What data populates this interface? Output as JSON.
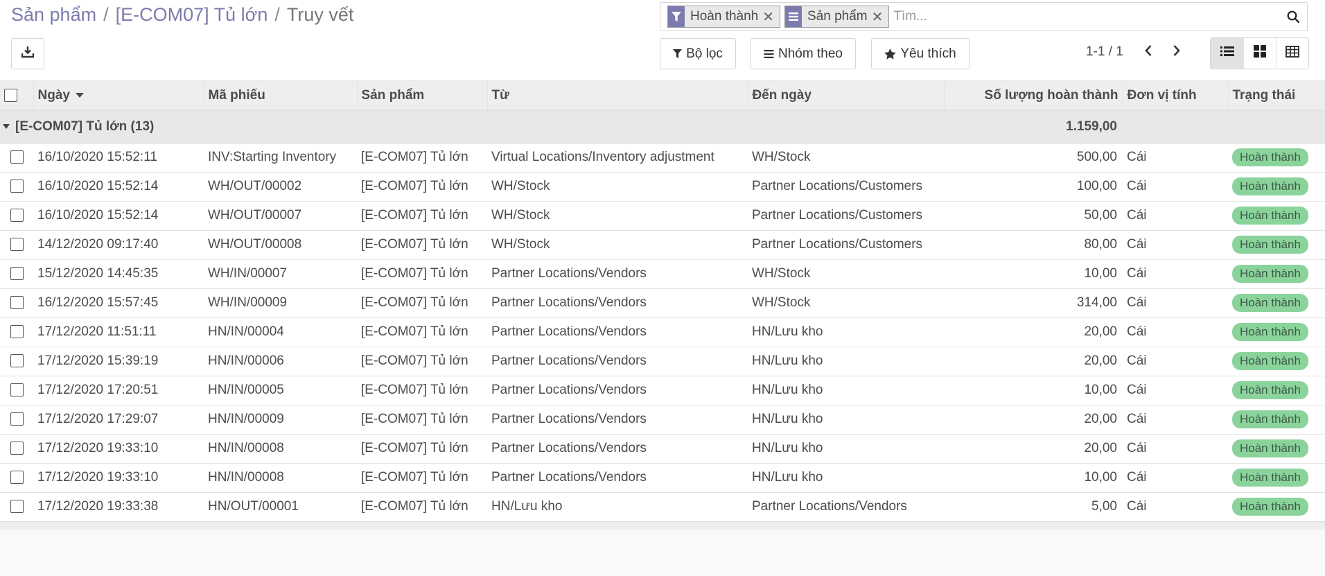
{
  "breadcrumb": {
    "items": [
      "Sản phẩm",
      "[E-COM07] Tủ lớn"
    ],
    "separator": "/",
    "current": "Truy vết"
  },
  "search": {
    "facets": [
      {
        "icon": "filter-icon",
        "value": "Hoàn thành"
      },
      {
        "icon": "group-by-icon",
        "value": "Sản phẩm"
      }
    ],
    "placeholder": "Tìm..."
  },
  "toolbar": {
    "filter_label": "Bộ lọc",
    "group_label": "Nhóm theo",
    "favorites_label": "Yêu thích"
  },
  "pager": {
    "text": "1-1 / 1"
  },
  "colors": {
    "accent": "#7c7bad",
    "badge_bg": "#8ad49c",
    "badge_text": "#3d5a46"
  },
  "table": {
    "headers": {
      "date": "Ngày",
      "reference": "Mã phiếu",
      "product": "Sản phẩm",
      "from": "Từ",
      "to": "Đến ngày",
      "qty_done": "Số lượng hoàn thành",
      "uom": "Đơn vị tính",
      "status": "Trạng thái"
    },
    "group": {
      "label": "[E-COM07] Tủ lớn (13)",
      "total": "1.159,00"
    },
    "rows": [
      {
        "date": "16/10/2020 15:52:11",
        "reference": "INV:Starting Inventory",
        "product": "[E-COM07] Tủ lớn",
        "from": "Virtual Locations/Inventory adjustment",
        "to": "WH/Stock",
        "qty": "500,00",
        "uom": "Cái",
        "status": "Hoàn thành"
      },
      {
        "date": "16/10/2020 15:52:14",
        "reference": "WH/OUT/00002",
        "product": "[E-COM07] Tủ lớn",
        "from": "WH/Stock",
        "to": "Partner Locations/Customers",
        "qty": "100,00",
        "uom": "Cái",
        "status": "Hoàn thành"
      },
      {
        "date": "16/10/2020 15:52:14",
        "reference": "WH/OUT/00007",
        "product": "[E-COM07] Tủ lớn",
        "from": "WH/Stock",
        "to": "Partner Locations/Customers",
        "qty": "50,00",
        "uom": "Cái",
        "status": "Hoàn thành"
      },
      {
        "date": "14/12/2020 09:17:40",
        "reference": "WH/OUT/00008",
        "product": "[E-COM07] Tủ lớn",
        "from": "WH/Stock",
        "to": "Partner Locations/Customers",
        "qty": "80,00",
        "uom": "Cái",
        "status": "Hoàn thành"
      },
      {
        "date": "15/12/2020 14:45:35",
        "reference": "WH/IN/00007",
        "product": "[E-COM07] Tủ lớn",
        "from": "Partner Locations/Vendors",
        "to": "WH/Stock",
        "qty": "10,00",
        "uom": "Cái",
        "status": "Hoàn thành"
      },
      {
        "date": "16/12/2020 15:57:45",
        "reference": "WH/IN/00009",
        "product": "[E-COM07] Tủ lớn",
        "from": "Partner Locations/Vendors",
        "to": "WH/Stock",
        "qty": "314,00",
        "uom": "Cái",
        "status": "Hoàn thành"
      },
      {
        "date": "17/12/2020 11:51:11",
        "reference": "HN/IN/00004",
        "product": "[E-COM07] Tủ lớn",
        "from": "Partner Locations/Vendors",
        "to": "HN/Lưu kho",
        "qty": "20,00",
        "uom": "Cái",
        "status": "Hoàn thành"
      },
      {
        "date": "17/12/2020 15:39:19",
        "reference": "HN/IN/00006",
        "product": "[E-COM07] Tủ lớn",
        "from": "Partner Locations/Vendors",
        "to": "HN/Lưu kho",
        "qty": "20,00",
        "uom": "Cái",
        "status": "Hoàn thành"
      },
      {
        "date": "17/12/2020 17:20:51",
        "reference": "HN/IN/00005",
        "product": "[E-COM07] Tủ lớn",
        "from": "Partner Locations/Vendors",
        "to": "HN/Lưu kho",
        "qty": "10,00",
        "uom": "Cái",
        "status": "Hoàn thành"
      },
      {
        "date": "17/12/2020 17:29:07",
        "reference": "HN/IN/00009",
        "product": "[E-COM07] Tủ lớn",
        "from": "Partner Locations/Vendors",
        "to": "HN/Lưu kho",
        "qty": "20,00",
        "uom": "Cái",
        "status": "Hoàn thành"
      },
      {
        "date": "17/12/2020 19:33:10",
        "reference": "HN/IN/00008",
        "product": "[E-COM07] Tủ lớn",
        "from": "Partner Locations/Vendors",
        "to": "HN/Lưu kho",
        "qty": "20,00",
        "uom": "Cái",
        "status": "Hoàn thành"
      },
      {
        "date": "17/12/2020 19:33:10",
        "reference": "HN/IN/00008",
        "product": "[E-COM07] Tủ lớn",
        "from": "Partner Locations/Vendors",
        "to": "HN/Lưu kho",
        "qty": "10,00",
        "uom": "Cái",
        "status": "Hoàn thành"
      },
      {
        "date": "17/12/2020 19:33:38",
        "reference": "HN/OUT/00001",
        "product": "[E-COM07] Tủ lớn",
        "from": "HN/Lưu kho",
        "to": "Partner Locations/Vendors",
        "qty": "5,00",
        "uom": "Cái",
        "status": "Hoàn thành"
      }
    ]
  }
}
